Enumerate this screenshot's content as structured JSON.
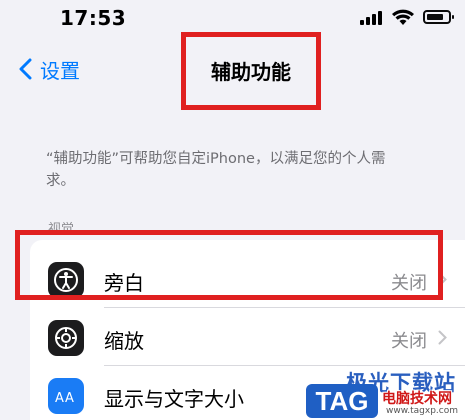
{
  "status_bar": {
    "time": "17:53"
  },
  "nav": {
    "back_label": "设置",
    "title": "辅助功能"
  },
  "description": "“辅助功能”可帮助您自定iPhone，以满足您的个人需求。",
  "section": {
    "header": "视觉"
  },
  "rows": [
    {
      "label": "旁白",
      "value": "关闭",
      "icon": "voiceover-icon",
      "icon_color": "#1c1c1e"
    },
    {
      "label": "缩放",
      "value": "关闭",
      "icon": "zoom-icon",
      "icon_color": "#1c1c1e"
    },
    {
      "label": "显示与文字大小",
      "value": "",
      "icon": "text-size-icon",
      "icon_color": "#1a7cf5"
    }
  ],
  "watermark": {
    "brand": "极光下载站",
    "tag": "TAG",
    "sub": "电脑技术网",
    "url": "www.tagxp.com"
  },
  "colors": {
    "accent": "#007aff",
    "highlight": "#e02020",
    "background": "#f2f2f7"
  }
}
